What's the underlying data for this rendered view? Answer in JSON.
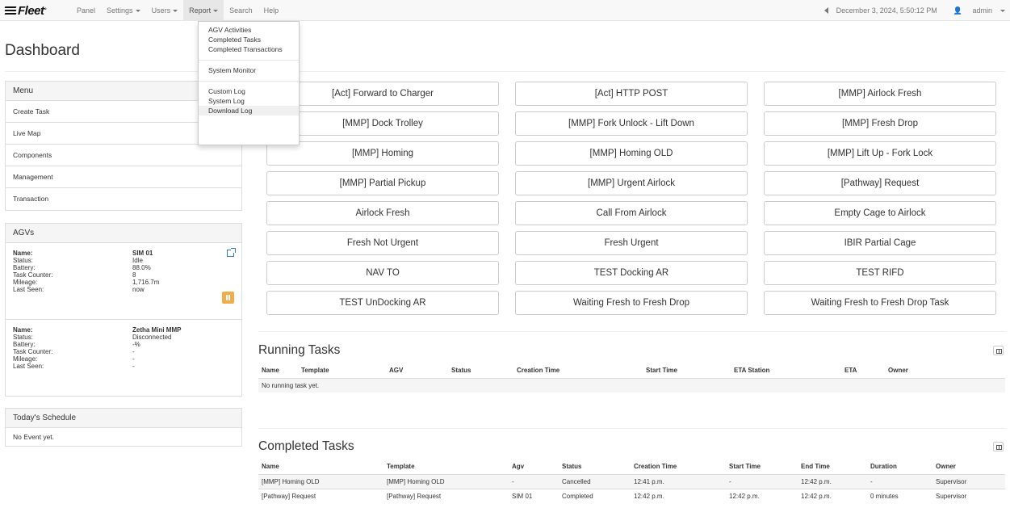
{
  "navbar": {
    "brand": "Fleet",
    "items": [
      {
        "label": "Panel"
      },
      {
        "label": "Settings"
      },
      {
        "label": "Users"
      },
      {
        "label": "Report"
      },
      {
        "label": "Search"
      },
      {
        "label": "Help"
      }
    ],
    "datetime": "December 3, 2024, 5:50:12 PM",
    "user": "admin"
  },
  "report_menu": {
    "items": [
      "AGV Activities",
      "Completed Tasks",
      "Completed Transactions",
      "System Monitor",
      "Custom Log",
      "System Log",
      "Download Log"
    ]
  },
  "page_title": "Dashboard",
  "menu": {
    "title": "Menu",
    "items": [
      "Create Task",
      "Live Map",
      "Components",
      "Management",
      "Transaction"
    ]
  },
  "agvs": {
    "title": "AGVs",
    "labels": {
      "name": "Name:",
      "status": "Status:",
      "battery": "Battery:",
      "task_counter": "Task Counter:",
      "mileage": "Mileage:",
      "last_seen": "Last Seen:"
    },
    "items": [
      {
        "name": "SIM 01",
        "status": "Idle",
        "battery": "88.0%",
        "task_counter": "8",
        "mileage": "1,716.7m",
        "last_seen": "now"
      },
      {
        "name": "Zetha Mini MMP",
        "status": "Disconnected",
        "battery": "-%",
        "task_counter": "-",
        "mileage": "-",
        "last_seen": "-"
      }
    ]
  },
  "schedule": {
    "title": "Today's Schedule",
    "empty": "No Event yet."
  },
  "task_buttons": [
    "[Act] Forward to Charger",
    "[Act] HTTP POST",
    "[MMP] Airlock Fresh",
    "[MMP] Dock Trolley",
    "[MMP] Fork Unlock - Lift Down",
    "[MMP] Fresh Drop",
    "[MMP] Homing",
    "[MMP] Homing OLD",
    "[MMP] Lift Up - Fork Lock",
    "[MMP] Partial Pickup",
    "[MMP] Urgent Airlock",
    "[Pathway] Request",
    "Airlock Fresh",
    "Call From Airlock",
    "Empty Cage to Airlock",
    "Fresh Not Urgent",
    "Fresh Urgent",
    "IBIR Partial Cage",
    "NAV TO",
    "TEST Docking AR",
    "TEST RIFD",
    "TEST UnDocking AR",
    "Waiting Fresh to Fresh Drop",
    "Waiting Fresh to Fresh Drop Task"
  ],
  "running_tasks": {
    "title": "Running Tasks",
    "columns": [
      "Name",
      "Template",
      "AGV",
      "Status",
      "Creation Time",
      "Start Time",
      "ETA Station",
      "ETA",
      "Owner"
    ],
    "empty": "No running task yet."
  },
  "completed_tasks": {
    "title": "Completed Tasks",
    "columns": [
      "Name",
      "Template",
      "Agv",
      "Status",
      "Creation Time",
      "Start Time",
      "End Time",
      "Duration",
      "Owner"
    ],
    "rows": [
      [
        "[MMP] Homing OLD",
        "[MMP] Homing OLD",
        "-",
        "Cancelled",
        "12:41 p.m.",
        "-",
        "12:42 p.m.",
        "-",
        "Supervisor"
      ],
      [
        "[Pathway] Request",
        "[Pathway] Request",
        "SIM 01",
        "Completed",
        "12:42 p.m.",
        "12:42 p.m.",
        "12:42 p.m.",
        "0 minutes",
        "Supervisor"
      ]
    ]
  }
}
